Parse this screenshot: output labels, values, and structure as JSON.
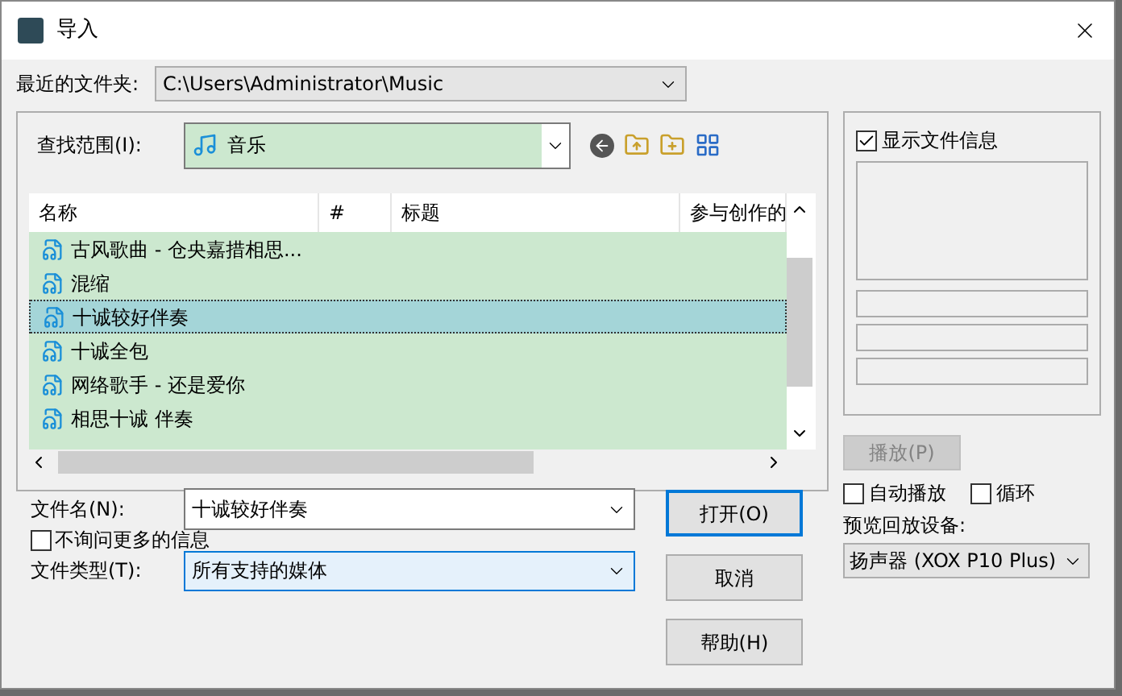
{
  "window": {
    "title": "导入"
  },
  "recent_folder": {
    "label": "最近的文件夹:",
    "value": "C:\\Users\\Administrator\\Music"
  },
  "look_in": {
    "label": "查找范围(I):",
    "value": "音乐"
  },
  "columns": [
    "名称",
    "#",
    "标题",
    "参与创作的"
  ],
  "files": [
    {
      "name": "古风歌曲 - 仓央嘉措相思...",
      "selected": false
    },
    {
      "name": "混缩",
      "selected": false
    },
    {
      "name": "十诚较好伴奏",
      "selected": true
    },
    {
      "name": "十诚全包",
      "selected": false
    },
    {
      "name": "网络歌手 - 还是爱你",
      "selected": false
    },
    {
      "name": "相思十诚 伴奏",
      "selected": false
    }
  ],
  "file_name": {
    "label": "文件名(N):",
    "value": "十诚较好伴奏"
  },
  "dont_ask": {
    "label": "不询问更多的信息",
    "checked": false
  },
  "file_type": {
    "label": "文件类型(T):",
    "value": "所有支持的媒体"
  },
  "buttons": [
    {
      "label": "打开(O)",
      "kind": "default"
    },
    {
      "label": "取消",
      "kind": "normal"
    },
    {
      "label": "帮助(H)",
      "kind": "normal"
    }
  ],
  "file_info": {
    "label": "显示文件信息",
    "checked": true
  },
  "play_button": {
    "label": "播放(P)",
    "disabled": true
  },
  "auto_play": {
    "label": "自动播放",
    "checked": false
  },
  "loop": {
    "label": "循环",
    "checked": false
  },
  "preview_device": {
    "label": "预览回放设备:",
    "value": "扬声器 (XOX P10 Plus)"
  }
}
